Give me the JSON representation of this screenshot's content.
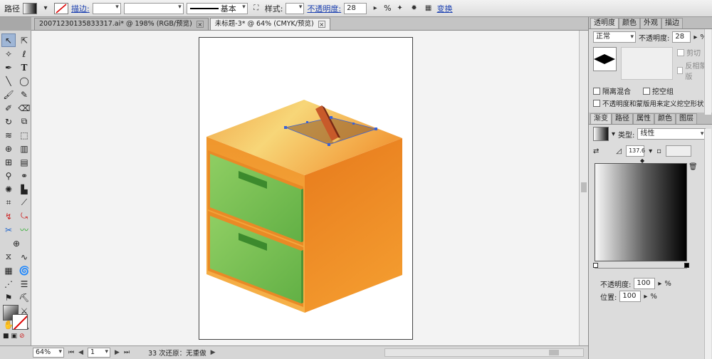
{
  "control_bar": {
    "object_type": "路径",
    "stroke_label": "描边:",
    "stroke_weight_value": "",
    "brush_label": "基本",
    "style_label": "样式:",
    "opacity_label": "不透明度:",
    "opacity_value": "28",
    "opacity_unit": "%",
    "transform_label": "变换"
  },
  "doc_tabs": [
    {
      "label": "20071230135833317.ai* @ 198% (RGB/预览)",
      "active": false
    },
    {
      "label": "未标题-3* @ 64% (CMYK/预览)",
      "active": true
    }
  ],
  "status_bar": {
    "zoom": "64%",
    "artboard_num": "1",
    "undo_info": "33 次还原：无重做"
  },
  "transparency_panel": {
    "tabs": [
      "透明度",
      "颜色",
      "外观",
      "描边"
    ],
    "blend_mode": "正常",
    "opacity_label": "不透明度:",
    "opacity_value": "28",
    "opacity_unit": "%",
    "clip_label": "剪切",
    "invert_mask_label": "反相蒙版",
    "isolate_blend_label": "隔离混合",
    "knockout_label": "挖空组",
    "opacity_mask_label": "不透明度和蒙版用来定义挖空形状"
  },
  "gradient_panel": {
    "tabs": [
      "渐变",
      "路径",
      "属性",
      "颜色",
      "图层"
    ],
    "type_label": "类型:",
    "type_value": "线性",
    "angle_value": "137.6",
    "stop_opacity_label": "不透明度:",
    "stop_opacity_value": "100",
    "stop_opacity_unit": "%",
    "location_label": "位置:",
    "location_value": "100",
    "location_unit": "%"
  },
  "colors": {
    "box_top": "#f3c660",
    "box_side": "#ec8a22",
    "drawer_green": "#72bd4e",
    "selection_blue": "#3a62d6"
  }
}
